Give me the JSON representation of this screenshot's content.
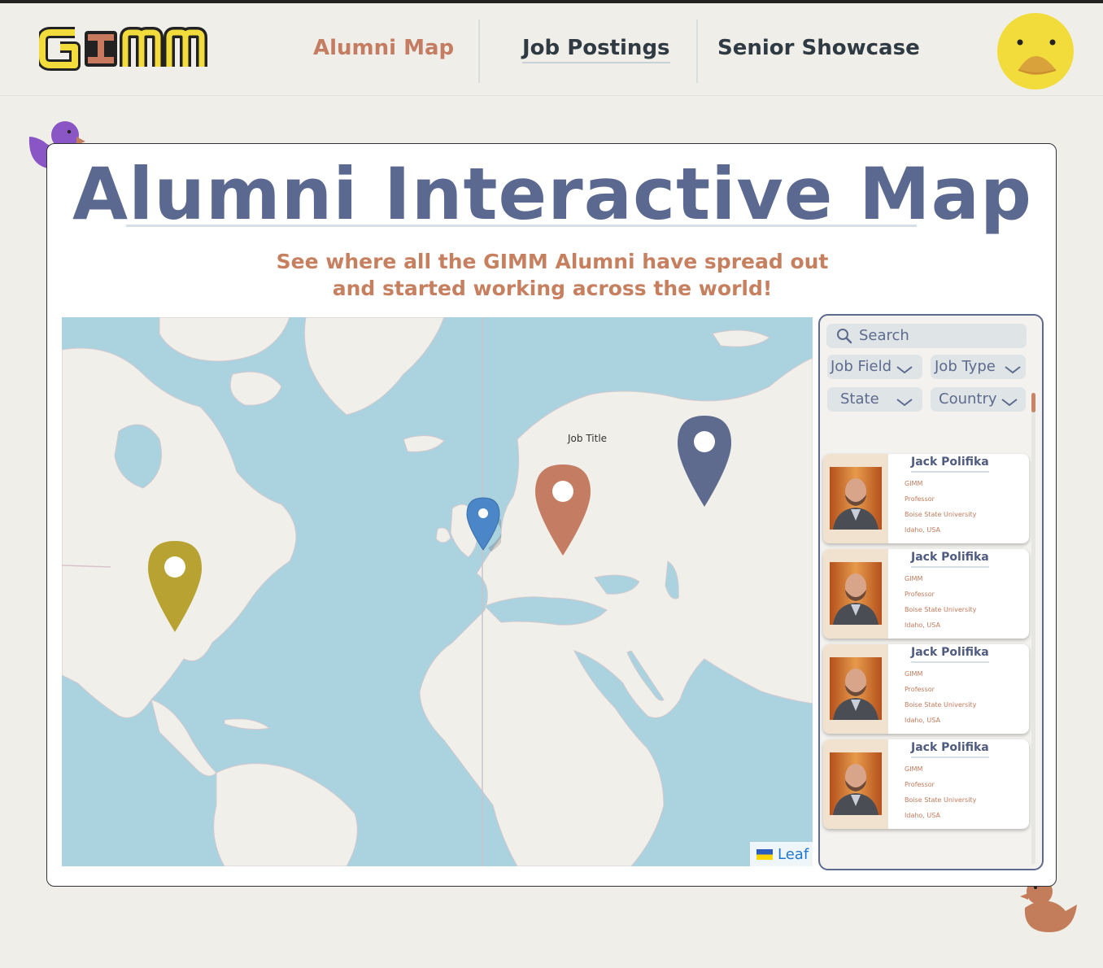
{
  "nav": {
    "logo_text": "GIMM",
    "links": [
      "Alumni Map",
      "Job Postings",
      "Senior Showcase"
    ]
  },
  "hero": {
    "title": "Alumni Interactive Map",
    "subtitle_line1": "See where all the GIMM Alumni have spread out",
    "subtitle_line2": "and started working across the world!"
  },
  "map": {
    "tooltip": "Job Title",
    "attribution": "Leaf",
    "pin_colors": [
      "#b8a232",
      "#4b86c8",
      "#c47d62",
      "#5e6a8e"
    ]
  },
  "sidebar": {
    "search_placeholder": "Search",
    "filters": [
      "Job Field",
      "Job Type",
      "State",
      "Country"
    ],
    "alumni": [
      {
        "name": "Jack Polifika",
        "program": "GIMM",
        "title": "Professor",
        "employer": "Boise State University",
        "location": "Idaho, USA"
      },
      {
        "name": "Jack Polifika",
        "program": "GIMM",
        "title": "Professor",
        "employer": "Boise State University",
        "location": "Idaho, USA"
      },
      {
        "name": "Jack Polifika",
        "program": "GIMM",
        "title": "Professor",
        "employer": "Boise State University",
        "location": "Idaho, USA"
      },
      {
        "name": "Jack Polifika",
        "program": "GIMM",
        "title": "Professor",
        "employer": "Boise State University",
        "location": "Idaho, USA"
      }
    ]
  },
  "colors": {
    "accent": "#c47d62",
    "navy": "#5e6a8e",
    "background": "#efeee9",
    "duck_yellow": "#f2dc3c",
    "duck_purple": "#8a55c4",
    "duck_orange": "#c47d5a"
  }
}
